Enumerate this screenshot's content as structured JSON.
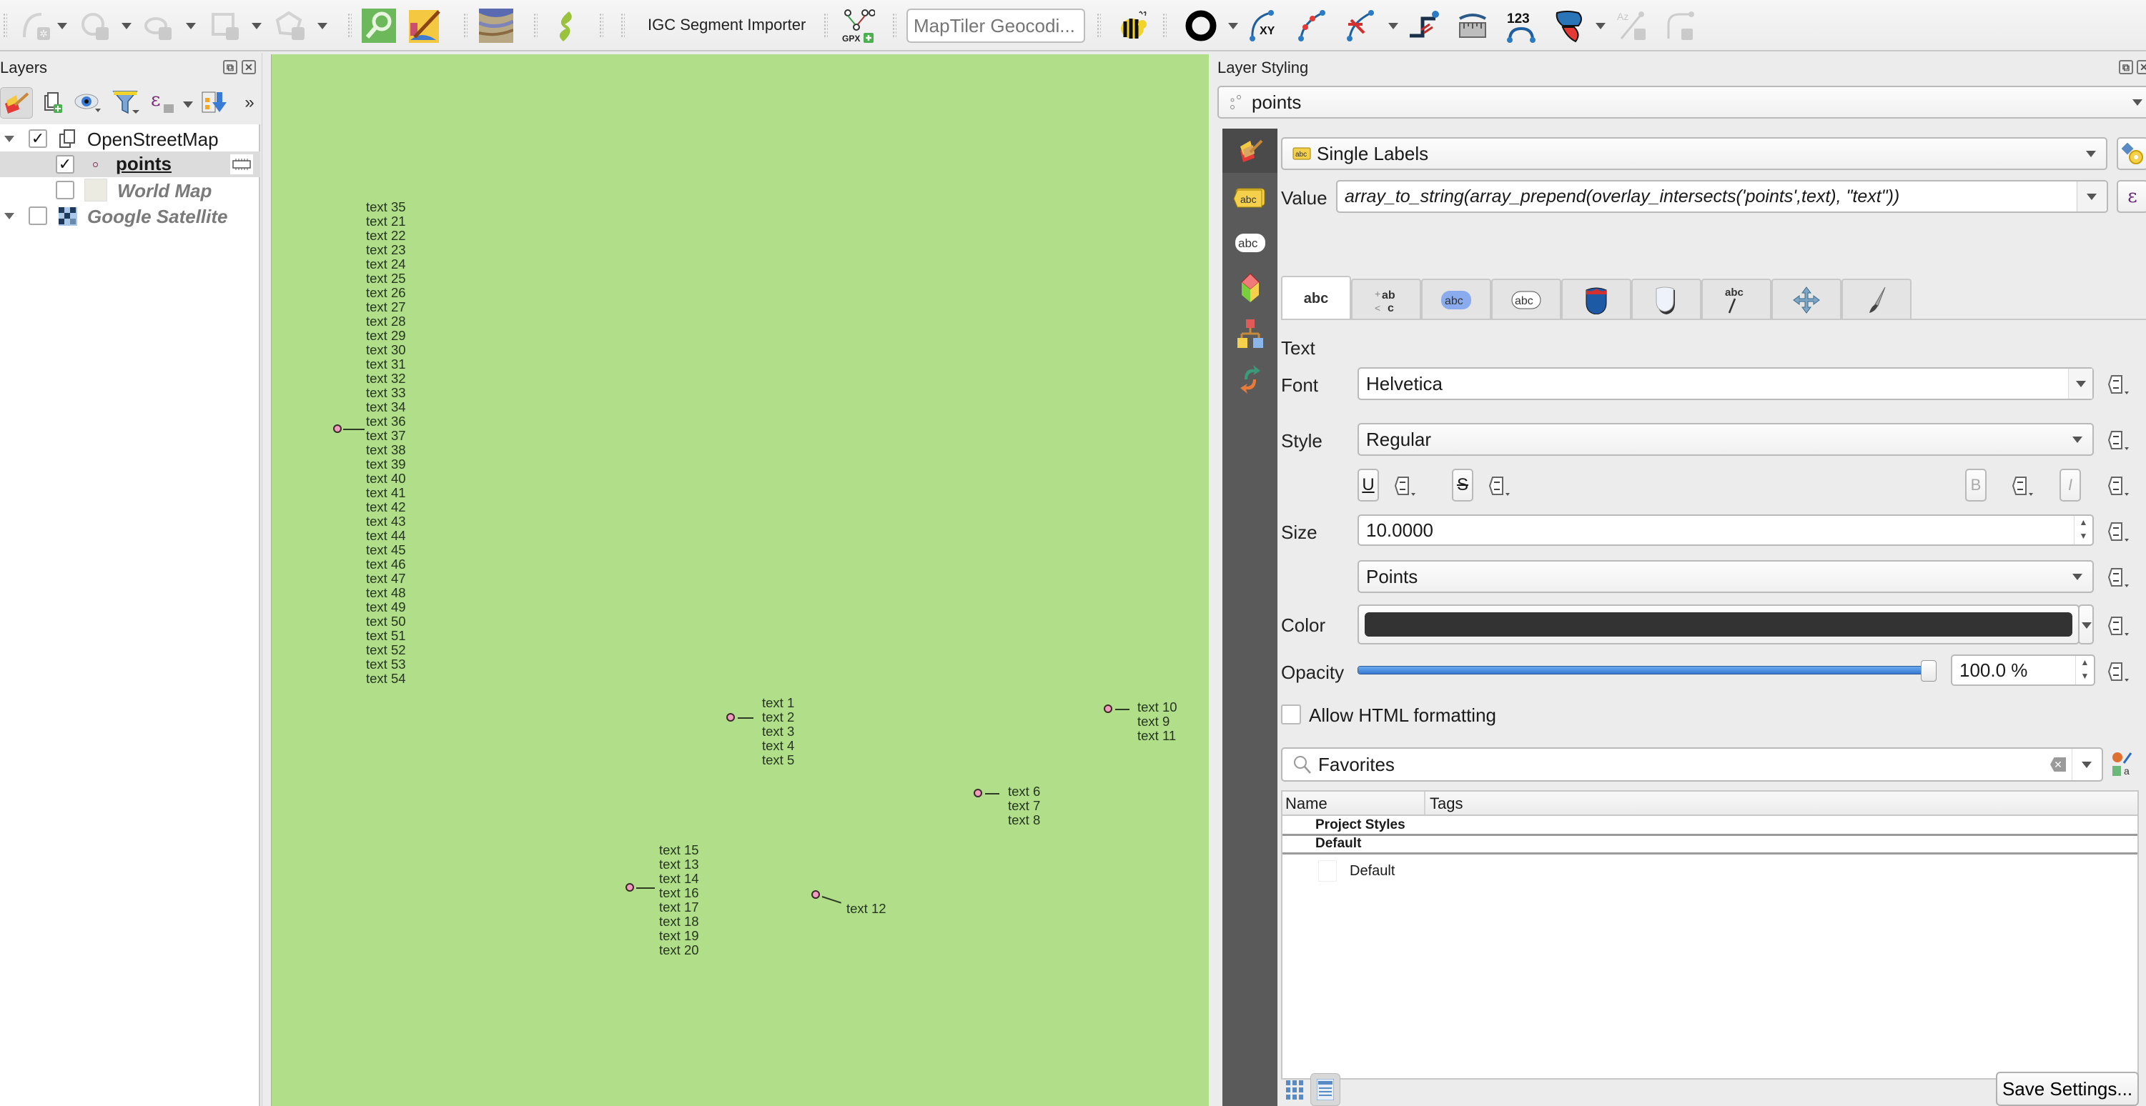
{
  "toolbar": {
    "igc_label": "IGC Segment Importer",
    "geocoder_placeholder": "MapTiler Geocodi...",
    "gpx_label": "GPX",
    "icons_left": [
      "digitize-curve-icon",
      "digitize-circle-icon",
      "digitize-ellipse-icon",
      "digitize-rectangle-icon",
      "digitize-polygon-icon"
    ],
    "icons_right": [
      "buffer-ring-icon",
      "xy-icon",
      "vertex-add-icon",
      "vertex-delete-icon",
      "split-line-icon",
      "measure-icon",
      "numbering-icon",
      "shape-tool-icon",
      "label-path-icon",
      "node-tool-icon"
    ]
  },
  "layers_panel": {
    "title": "Layers",
    "tree": [
      {
        "name": "OpenStreetMap",
        "checked": true,
        "expanded": true,
        "type": "group"
      },
      {
        "name": "points",
        "checked": true,
        "type": "point-layer",
        "selected": true
      },
      {
        "name": "World Map",
        "checked": false,
        "type": "raster"
      },
      {
        "name": "Google Satellite",
        "checked": false,
        "expanded": true,
        "type": "group"
      }
    ]
  },
  "map": {
    "background": "#b1de88",
    "point_color": "#f29cc0",
    "clusters": [
      {
        "labels": [
          "text 35",
          "text 21",
          "text 22",
          "text 23",
          "text 24",
          "text 25",
          "text 26",
          "text 27",
          "text 28",
          "text 29",
          "text 30",
          "text 31",
          "text 32",
          "text 33",
          "text 34",
          "text 36",
          "text 37",
          "text 38",
          "text 39",
          "text 40",
          "text 41",
          "text 42",
          "text 43",
          "text 44",
          "text 45",
          "text 46",
          "text 47",
          "text 48",
          "text 49",
          "text 50",
          "text 51",
          "text 52",
          "text 53",
          "text 54"
        ]
      },
      {
        "labels": [
          "text 1",
          "text 2",
          "text 3",
          "text 4",
          "text 5"
        ]
      },
      {
        "labels": [
          "text 10",
          "text 9",
          "text 11"
        ]
      },
      {
        "labels": [
          "text 6",
          "text 7",
          "text 8"
        ]
      },
      {
        "labels": [
          "text 15",
          "text 13",
          "text 14",
          "text 16",
          "text 17",
          "text 18",
          "text 19",
          "text 20"
        ]
      },
      {
        "labels": [
          "text 12"
        ]
      }
    ]
  },
  "style_panel": {
    "title": "Layer Styling",
    "layer_select": "points",
    "renderer": "Single Labels",
    "value_label": "Value",
    "value_expression": "array_to_string(array_prepend(overlay_intersects('points',text), \"text\"))",
    "section_title": "Text",
    "font_label": "Font",
    "font_value": "Helvetica",
    "style_label": "Style",
    "style_value": "Regular",
    "underline": "U",
    "strikeout": "S",
    "bold": "B",
    "italic": "I",
    "size_label": "Size",
    "size_value": "10.0000",
    "size_unit": "Points",
    "color_label": "Color",
    "color_value": "#333333",
    "opacity_label": "Opacity",
    "opacity_value": "100.0 %",
    "opacity_fraction": 1.0,
    "allow_html_label": "Allow HTML formatting",
    "allow_html_checked": false,
    "search_value": "Favorites",
    "list_headers": [
      "Name",
      "Tags"
    ],
    "list_groups": [
      "Project Styles",
      "Default"
    ],
    "list_items": [
      "Default"
    ],
    "save_settings": "Save Settings...",
    "tabs": [
      "text-tab",
      "formatting-tab",
      "buffer-tab",
      "mask-tab",
      "background-tab",
      "shadow-tab",
      "callouts-tab",
      "placement-tab",
      "rendering-tab"
    ],
    "accent_color": "#4a90e2"
  }
}
